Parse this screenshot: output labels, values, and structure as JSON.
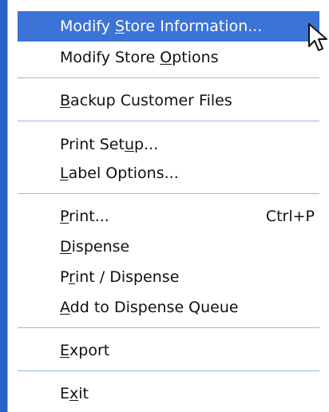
{
  "menu": {
    "items": [
      {
        "pre": "Modify ",
        "ul": "S",
        "post": "tore Information...",
        "selected": true
      },
      {
        "pre": "Modify Store ",
        "ul": "O",
        "post": "ptions"
      },
      {
        "pre": "",
        "ul": "B",
        "post": "ackup Customer Files"
      },
      {
        "pre": "Print Set",
        "ul": "u",
        "post": "p..."
      },
      {
        "pre": "",
        "ul": "L",
        "post": "abel Options..."
      },
      {
        "pre": "",
        "ul": "P",
        "post": "rint...",
        "shortcut": "Ctrl+P"
      },
      {
        "pre": "",
        "ul": "D",
        "post": "ispense"
      },
      {
        "pre": "P",
        "ul": "r",
        "post": "int / Dispense"
      },
      {
        "pre": "",
        "ul": "A",
        "post": "dd to Dispense Queue"
      },
      {
        "pre": "",
        "ul": "E",
        "post": "xport"
      },
      {
        "pre": "E",
        "ul": "x",
        "post": "it"
      }
    ]
  },
  "cursor_icon": "arrow-pointer-icon"
}
